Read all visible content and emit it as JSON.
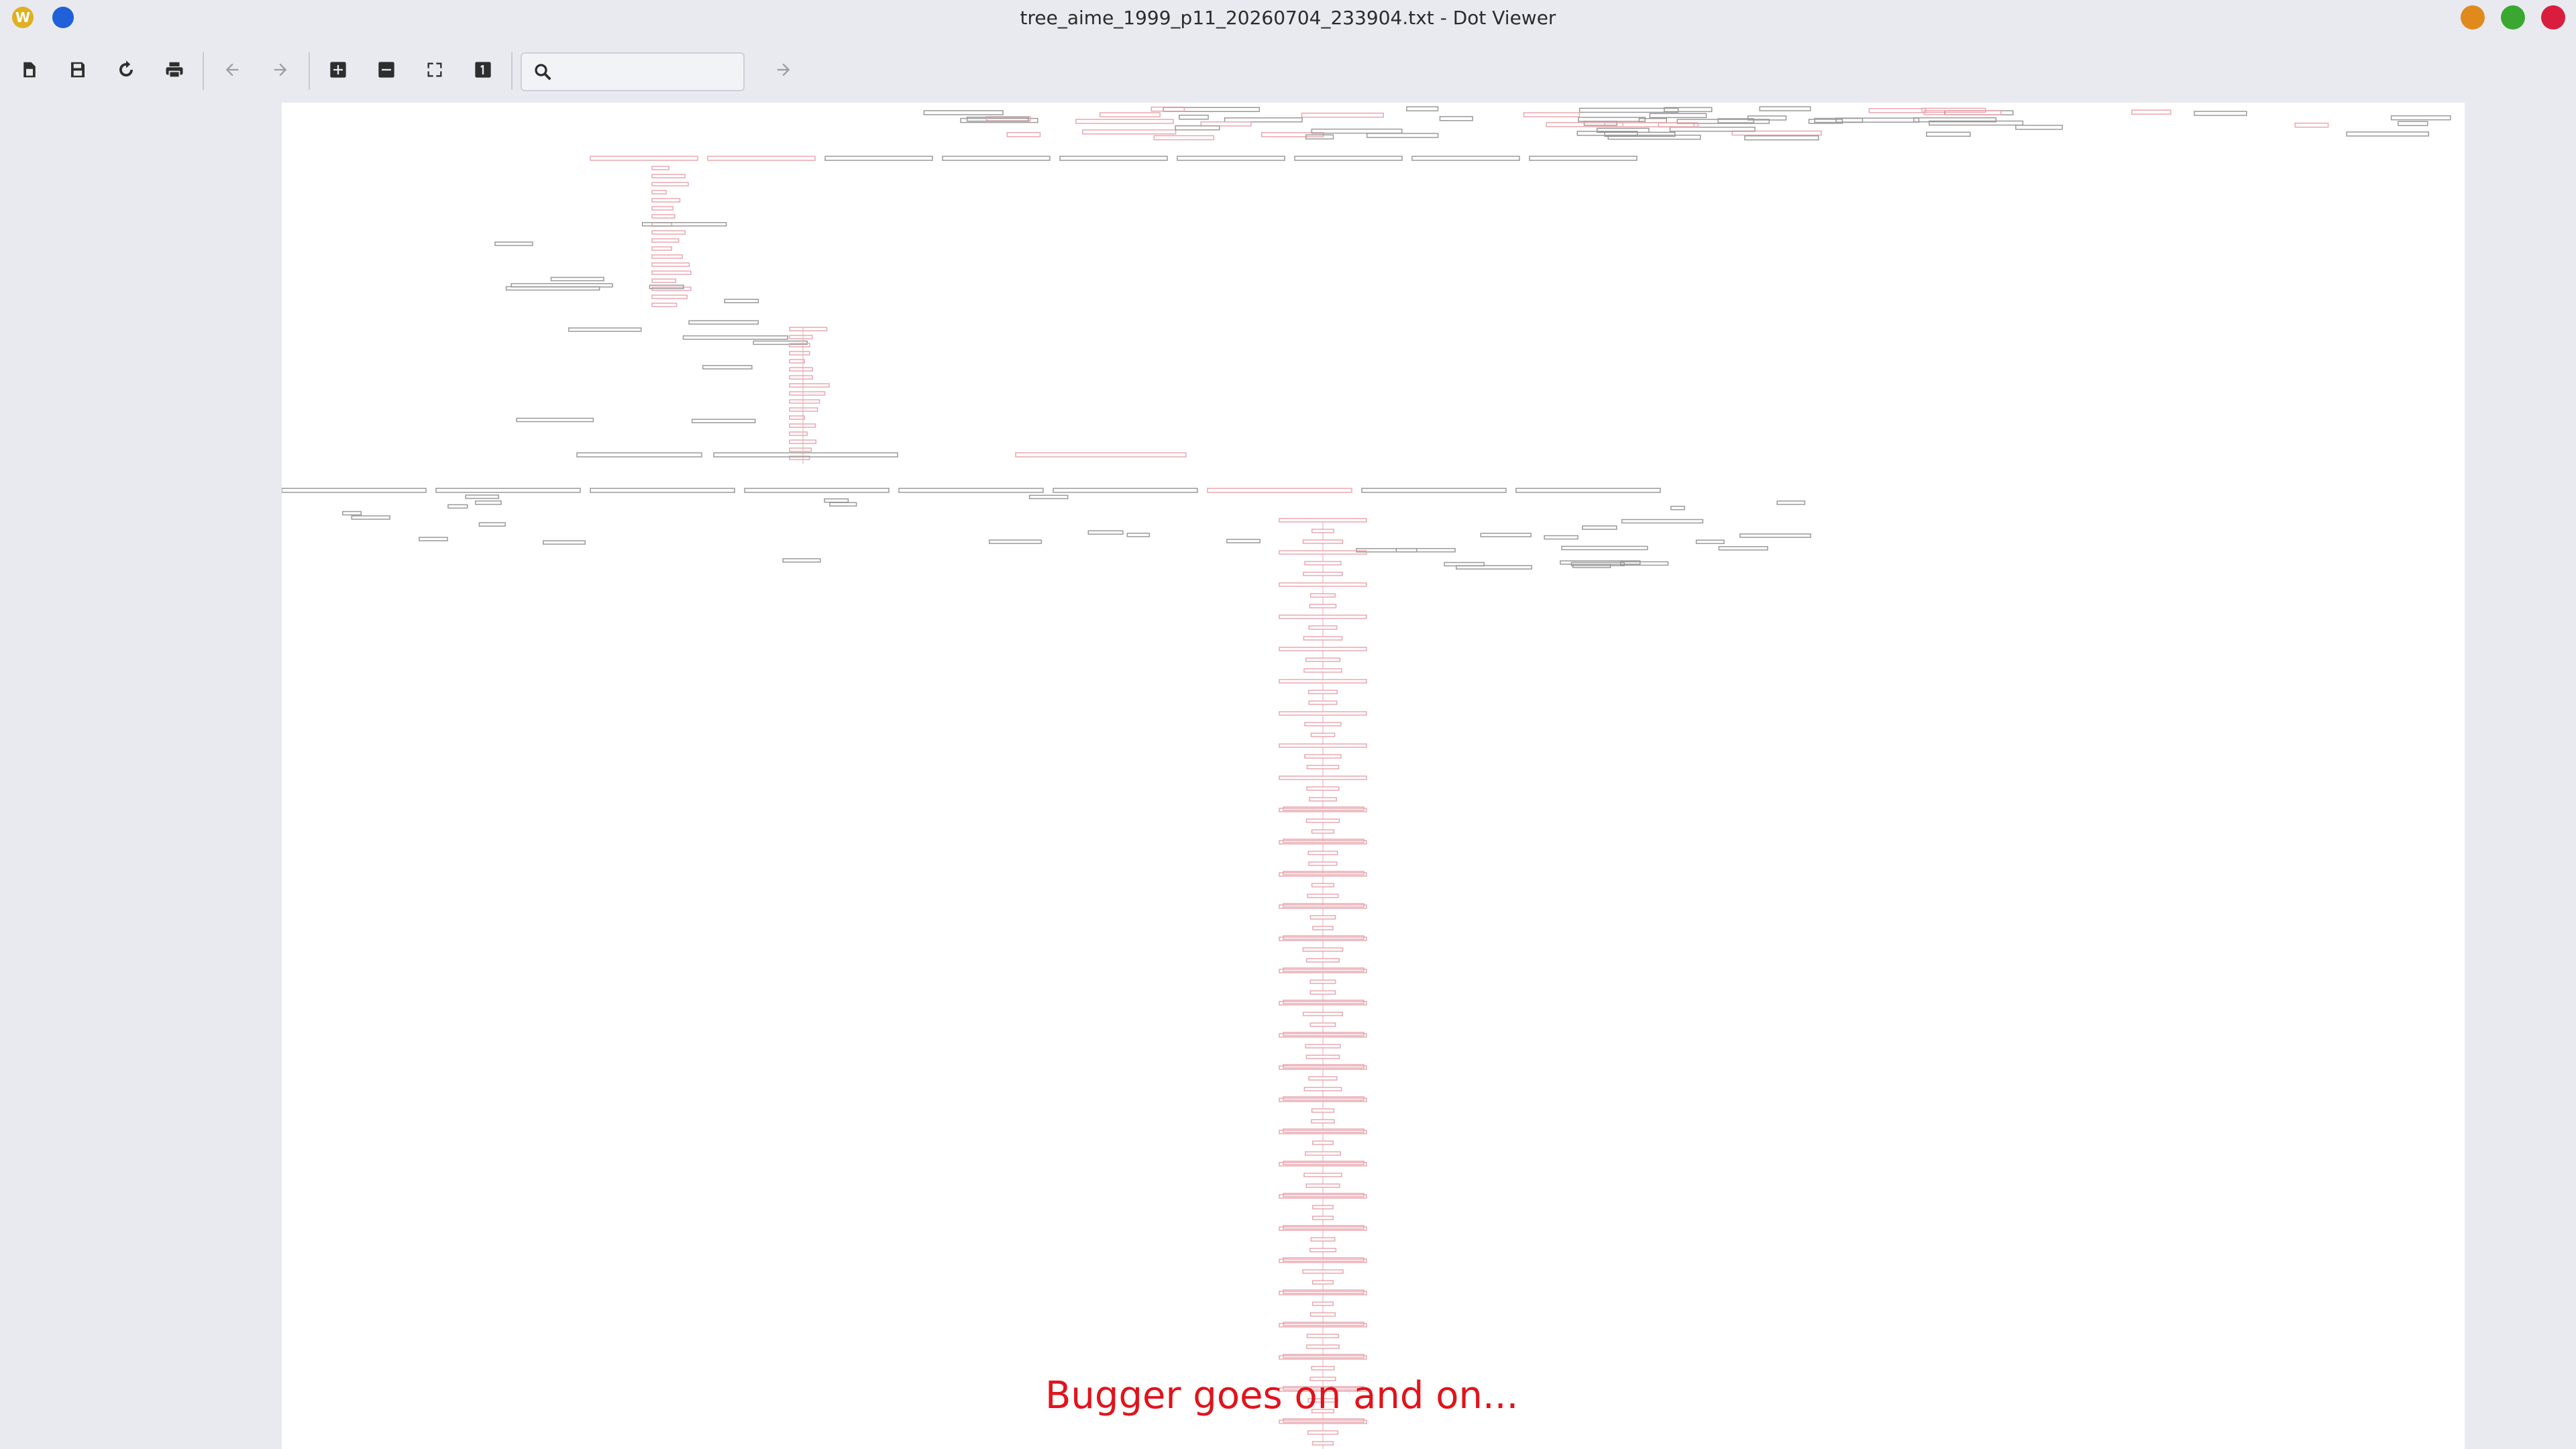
{
  "window": {
    "title": "tree_aime_1999_p11_20260704_233904.txt - Dot Viewer",
    "controls": [
      "minimize",
      "maximize",
      "close"
    ],
    "colors": {
      "minimize": "#e08a1e",
      "maximize": "#3aa830",
      "close": "#d81e3c"
    }
  },
  "toolbar": {
    "buttons": [
      {
        "name": "open-button",
        "icon": "open-file-icon"
      },
      {
        "name": "save-button",
        "icon": "save-icon"
      },
      {
        "name": "reload-button",
        "icon": "reload-icon"
      },
      {
        "name": "print-button",
        "icon": "print-icon"
      },
      {
        "name": "back-button",
        "icon": "arrow-left-icon"
      },
      {
        "name": "forward-button",
        "icon": "arrow-right-icon"
      },
      {
        "name": "zoom-in-button",
        "icon": "zoom-in-icon"
      },
      {
        "name": "zoom-out-button",
        "icon": "zoom-out-icon"
      },
      {
        "name": "zoom-fit-button",
        "icon": "fit-icon"
      },
      {
        "name": "zoom-100-button",
        "icon": "actual-size-icon"
      },
      {
        "name": "find-next-button",
        "icon": "arrow-right-icon"
      }
    ],
    "search": {
      "value": "",
      "placeholder": ""
    }
  },
  "graph": {
    "node_colors": {
      "highlight": "#e8a8b0",
      "normal": "#9a9a9a"
    }
  },
  "annotation": {
    "text": "Bugger goes on and on...",
    "color": "#e0141c"
  }
}
